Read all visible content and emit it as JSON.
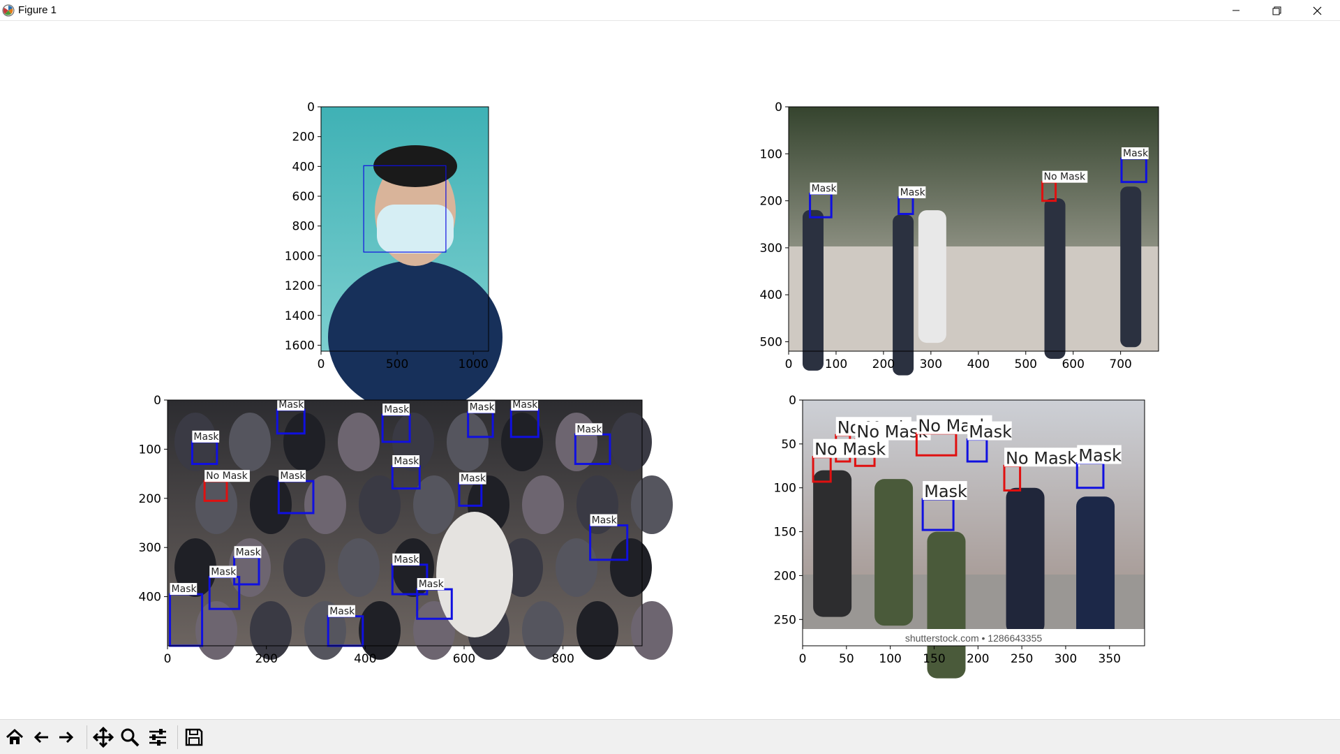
{
  "window": {
    "title": "Figure 1",
    "controls": [
      "minimize-icon",
      "restore-icon",
      "close-icon"
    ]
  },
  "toolbar": {
    "buttons": [
      {
        "name": "home-icon",
        "tooltip": "Reset original view"
      },
      {
        "name": "back-arrow-icon",
        "tooltip": "Back to previous view"
      },
      {
        "name": "forward-arrow-icon",
        "tooltip": "Forward to next view"
      },
      {
        "name": "pan-icon",
        "tooltip": "Pan axes"
      },
      {
        "name": "zoom-icon",
        "tooltip": "Zoom to rectangle"
      },
      {
        "name": "configure-subplots-icon",
        "tooltip": "Configure subplots"
      },
      {
        "name": "save-icon",
        "tooltip": "Save the figure"
      }
    ]
  },
  "colors": {
    "mask_box": "#1010e0",
    "no_mask_box": "#e01010",
    "label_bg": "#ffffff",
    "axis": "#000000"
  },
  "chart_data": [
    {
      "type": "image",
      "subplot": "top-left",
      "image_size": [
        1100,
        1640
      ],
      "xlim": [
        0,
        1100
      ],
      "ylim": [
        1640,
        0
      ],
      "xticks": [
        0,
        500,
        1000
      ],
      "yticks": [
        0,
        200,
        400,
        600,
        800,
        1000,
        1200,
        1400,
        1600
      ],
      "detections": [
        {
          "label": "",
          "x": 280,
          "y": 395,
          "w": 540,
          "h": 580,
          "class": "mask"
        }
      ]
    },
    {
      "type": "image",
      "subplot": "top-right",
      "image_size": [
        780,
        520
      ],
      "xlim": [
        0,
        780
      ],
      "ylim": [
        520,
        0
      ],
      "xticks": [
        0,
        100,
        200,
        300,
        400,
        500,
        600,
        700
      ],
      "yticks": [
        0,
        100,
        200,
        300,
        400,
        500
      ],
      "detections": [
        {
          "label": "Mask",
          "x": 45,
          "y": 185,
          "w": 45,
          "h": 50,
          "class": "mask"
        },
        {
          "label": "Mask",
          "x": 232,
          "y": 193,
          "w": 30,
          "h": 35,
          "class": "mask"
        },
        {
          "label": "No Mask",
          "x": 535,
          "y": 160,
          "w": 28,
          "h": 40,
          "class": "no_mask"
        },
        {
          "label": "Mask",
          "x": 702,
          "y": 110,
          "w": 52,
          "h": 50,
          "class": "mask"
        }
      ]
    },
    {
      "type": "image",
      "subplot": "bottom-left",
      "image_size": [
        960,
        500
      ],
      "xlim": [
        0,
        960
      ],
      "ylim": [
        500,
        0
      ],
      "xticks": [
        0,
        200,
        400,
        600,
        800
      ],
      "yticks": [
        0,
        100,
        200,
        300,
        400
      ],
      "detections": [
        {
          "label": "Mask",
          "x": 222,
          "y": 20,
          "w": 55,
          "h": 48,
          "class": "mask"
        },
        {
          "label": "Mask",
          "x": 435,
          "y": 30,
          "w": 55,
          "h": 55,
          "class": "mask"
        },
        {
          "label": "Mask",
          "x": 608,
          "y": 25,
          "w": 50,
          "h": 50,
          "class": "mask"
        },
        {
          "label": "Mask",
          "x": 695,
          "y": 20,
          "w": 55,
          "h": 55,
          "class": "mask"
        },
        {
          "label": "Mask",
          "x": 50,
          "y": 85,
          "w": 50,
          "h": 45,
          "class": "mask"
        },
        {
          "label": "Mask",
          "x": 825,
          "y": 70,
          "w": 70,
          "h": 60,
          "class": "mask"
        },
        {
          "label": "No Mask",
          "x": 75,
          "y": 165,
          "w": 45,
          "h": 40,
          "class": "no_mask"
        },
        {
          "label": "Mask",
          "x": 225,
          "y": 165,
          "w": 70,
          "h": 65,
          "class": "mask"
        },
        {
          "label": "Mask",
          "x": 455,
          "y": 135,
          "w": 55,
          "h": 45,
          "class": "mask"
        },
        {
          "label": "Mask",
          "x": 590,
          "y": 170,
          "w": 45,
          "h": 45,
          "class": "mask"
        },
        {
          "label": "Mask",
          "x": 855,
          "y": 255,
          "w": 75,
          "h": 70,
          "class": "mask"
        },
        {
          "label": "Mask",
          "x": 135,
          "y": 320,
          "w": 50,
          "h": 55,
          "class": "mask"
        },
        {
          "label": "Mask",
          "x": 85,
          "y": 360,
          "w": 60,
          "h": 65,
          "class": "mask"
        },
        {
          "label": "Mask",
          "x": 455,
          "y": 335,
          "w": 70,
          "h": 60,
          "class": "mask"
        },
        {
          "label": "Mask",
          "x": 505,
          "y": 385,
          "w": 70,
          "h": 60,
          "class": "mask"
        },
        {
          "label": "Mask",
          "x": 5,
          "y": 395,
          "w": 65,
          "h": 105,
          "class": "mask"
        },
        {
          "label": "Mask",
          "x": 325,
          "y": 440,
          "w": 70,
          "h": 60,
          "class": "mask"
        }
      ]
    },
    {
      "type": "image",
      "subplot": "bottom-right",
      "image_size": [
        390,
        280
      ],
      "xlim": [
        0,
        390
      ],
      "ylim": [
        280,
        0
      ],
      "xticks": [
        0,
        50,
        100,
        150,
        200,
        250,
        300,
        350
      ],
      "yticks": [
        0,
        50,
        100,
        150,
        200,
        250
      ],
      "watermark": "shutterstock.com • 1286643355",
      "detections": [
        {
          "label": "No Mask",
          "x": 38,
          "y": 40,
          "w": 16,
          "h": 30,
          "class": "no_mask"
        },
        {
          "label": "No Mask",
          "x": 60,
          "y": 45,
          "w": 22,
          "h": 30,
          "class": "no_mask"
        },
        {
          "label": "No Mask",
          "x": 130,
          "y": 38,
          "w": 45,
          "h": 25,
          "class": "no_mask"
        },
        {
          "label": "Mask",
          "x": 188,
          "y": 45,
          "w": 22,
          "h": 25,
          "class": "mask"
        },
        {
          "label": "No Mask",
          "x": 12,
          "y": 65,
          "w": 20,
          "h": 28,
          "class": "no_mask"
        },
        {
          "label": "No Mask",
          "x": 230,
          "y": 75,
          "w": 18,
          "h": 28,
          "class": "no_mask"
        },
        {
          "label": "Mask",
          "x": 313,
          "y": 72,
          "w": 30,
          "h": 28,
          "class": "mask"
        },
        {
          "label": "Mask",
          "x": 137,
          "y": 113,
          "w": 35,
          "h": 35,
          "class": "mask"
        }
      ]
    }
  ]
}
